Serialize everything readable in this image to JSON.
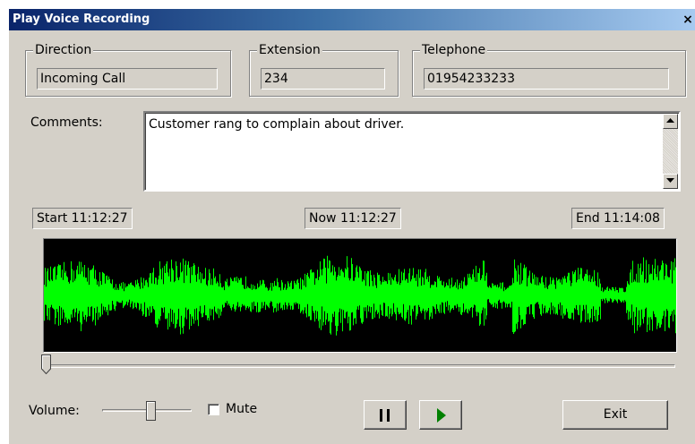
{
  "window": {
    "title": "Play Voice Recording",
    "close_glyph": "×"
  },
  "direction": {
    "label": "Direction",
    "value": "Incoming Call"
  },
  "extension": {
    "label": "Extension",
    "value": "234"
  },
  "telephone": {
    "label": "Telephone",
    "value": "01954233233"
  },
  "comments": {
    "label": "Comments:",
    "value": "Customer rang to complain about driver."
  },
  "times": {
    "start": "Start 11:12:27",
    "now": "Now 11:12:27",
    "end": "End 11:14:08"
  },
  "playback": {
    "position_fraction": 0.0,
    "waveform_color": "#00ff00"
  },
  "volume": {
    "label": "Volume:",
    "level_fraction": 0.55,
    "mute_label": "Mute",
    "muted": false
  },
  "buttons": {
    "exit_label": "Exit",
    "pause_icon": "pause-icon",
    "play_icon": "play-icon"
  },
  "colors": {
    "play_triangle": "#008000",
    "title_bar_start": "#0a246a",
    "title_bar_end": "#a6caf0"
  }
}
